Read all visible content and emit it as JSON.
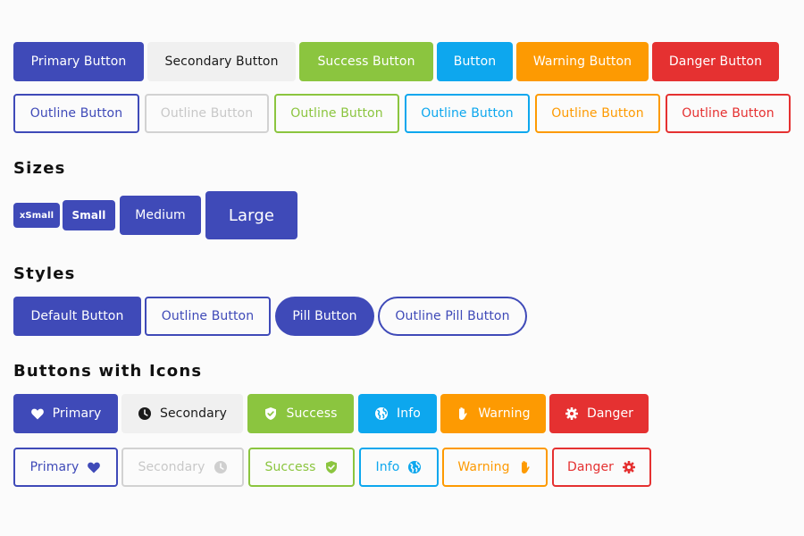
{
  "colors": {
    "primary": "#3f4ab8",
    "secondary_bg": "#f0f0f0",
    "secondary_text": "#1a1a1a",
    "success": "#8bc53f",
    "info": "#0da7ee",
    "warning": "#fd9a02",
    "danger": "#e53131",
    "disabled_outline": "#d2d2d2"
  },
  "solid_row": {
    "primary": "Primary Button",
    "secondary": "Secondary Button",
    "success": "Success Button",
    "info": "Button",
    "warning": "Warning Button",
    "danger": "Danger Button"
  },
  "outline_row": {
    "primary": "Outline Button",
    "secondary": "Outline Button",
    "success": "Outline Button",
    "info": "Outline Button",
    "warning": "Outline Button",
    "danger": "Outline Button"
  },
  "sizes": {
    "heading": "Sizes",
    "xsmall": "xSmall",
    "small": "Small",
    "medium": "Medium",
    "large": "Large"
  },
  "styles": {
    "heading": "Styles",
    "default": "Default Button",
    "outline": "Outline Button",
    "pill": "Pill Button",
    "outline_pill": "Outline Pill Button"
  },
  "icons_section": {
    "heading": "Buttons with Icons",
    "solid": {
      "primary": "Primary",
      "secondary": "Secondary",
      "success": "Success",
      "info": "Info",
      "warning": "Warning",
      "danger": "Danger"
    },
    "outline": {
      "primary": "Primary",
      "secondary": "Secondary",
      "success": "Success",
      "info": "Info",
      "warning": "Warning",
      "danger": "Danger"
    },
    "icon_names": {
      "primary": "heart-icon",
      "secondary": "clock-icon",
      "success": "shield-check-icon",
      "info": "globe-icon",
      "warning": "hand-icon",
      "danger": "gear-icon"
    }
  }
}
